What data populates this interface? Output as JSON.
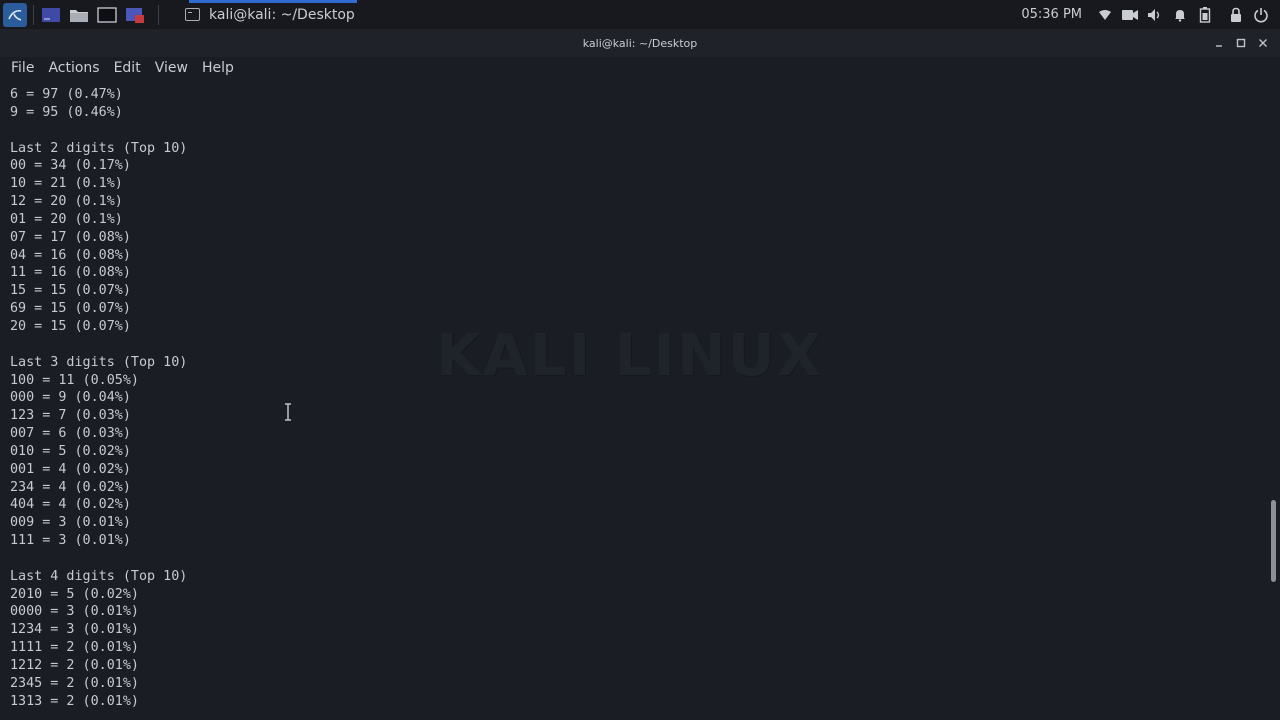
{
  "taskbar": {
    "active_task_label": "kali@kali: ~/Desktop",
    "clock": "05:36 PM",
    "icons": [
      "kali-menu-icon",
      "workspace-icon",
      "file-manager-icon",
      "terminal-icon",
      "media-icon"
    ],
    "tray_icons": [
      "shield-icon",
      "camera-icon",
      "volume-icon",
      "bell-icon",
      "battery-icon",
      "lock-icon",
      "power-icon"
    ]
  },
  "window": {
    "title": "kali@kali: ~/Desktop"
  },
  "menu": {
    "file": "File",
    "actions": "Actions",
    "edit": "Edit",
    "view": "View",
    "help": "Help"
  },
  "watermark": "KALI LINUX",
  "terminal": {
    "lines": [
      "6 = 97 (0.47%)",
      "9 = 95 (0.46%)",
      "",
      "Last 2 digits (Top 10)",
      "00 = 34 (0.17%)",
      "10 = 21 (0.1%)",
      "12 = 20 (0.1%)",
      "01 = 20 (0.1%)",
      "07 = 17 (0.08%)",
      "04 = 16 (0.08%)",
      "11 = 16 (0.08%)",
      "15 = 15 (0.07%)",
      "69 = 15 (0.07%)",
      "20 = 15 (0.07%)",
      "",
      "Last 3 digits (Top 10)",
      "100 = 11 (0.05%)",
      "000 = 9 (0.04%)",
      "123 = 7 (0.03%)",
      "007 = 6 (0.03%)",
      "010 = 5 (0.02%)",
      "001 = 4 (0.02%)",
      "234 = 4 (0.02%)",
      "404 = 4 (0.02%)",
      "009 = 3 (0.01%)",
      "111 = 3 (0.01%)",
      "",
      "Last 4 digits (Top 10)",
      "2010 = 5 (0.02%)",
      "0000 = 3 (0.01%)",
      "1234 = 3 (0.01%)",
      "1111 = 2 (0.01%)",
      "1212 = 2 (0.01%)",
      "2345 = 2 (0.01%)",
      "1313 = 2 (0.01%)"
    ]
  },
  "colors": {
    "background": "#1a1d23",
    "panel": "#17191e",
    "accent": "#2f6bd0",
    "text": "#c7cad0"
  }
}
